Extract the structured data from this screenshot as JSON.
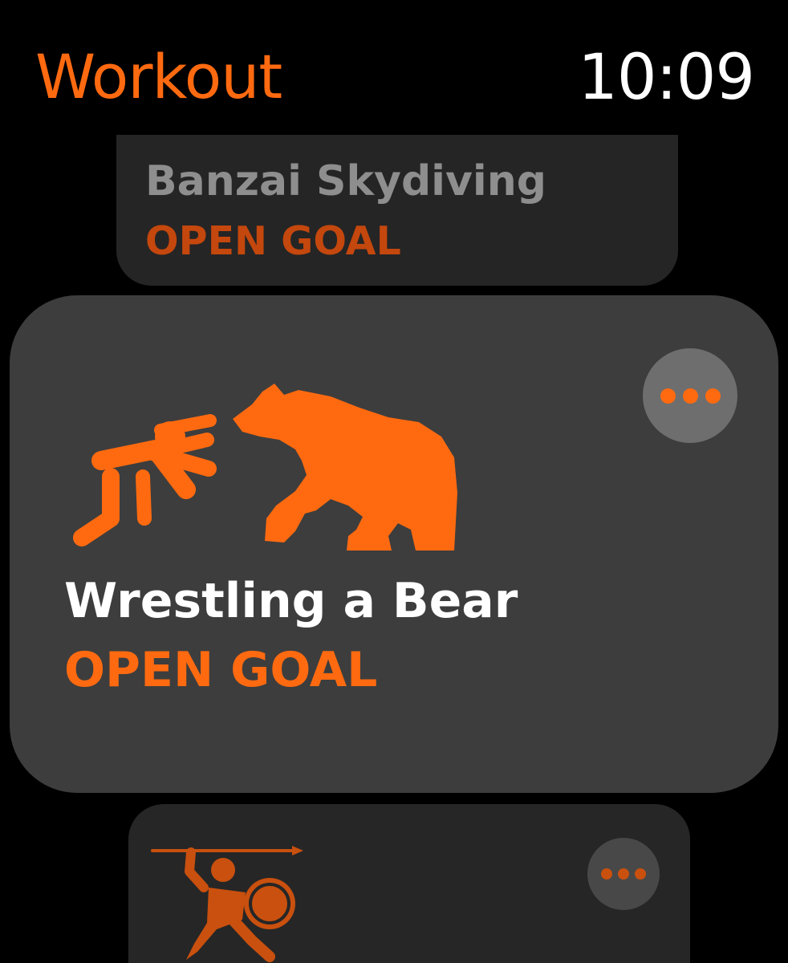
{
  "header": {
    "app_title": "Workout",
    "time": "10:09"
  },
  "workouts": [
    {
      "name": "Banzai Skydiving",
      "goal": "OPEN GOAL"
    },
    {
      "name": "Wrestling a Bear",
      "goal": "OPEN GOAL",
      "icon": "wrestler-and-bear-icon"
    },
    {
      "icon": "spartan-warrior-icon"
    }
  ],
  "colors": {
    "accent": "#FF6A10",
    "accent_dim": "#C4470D",
    "card_selected": "#3D3D3D",
    "card": "#252525",
    "background": "#000000"
  }
}
